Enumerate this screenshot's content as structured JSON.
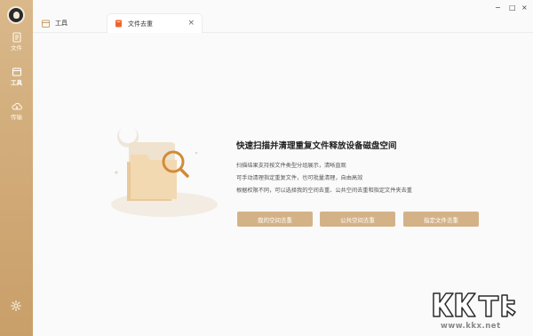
{
  "sidebar": {
    "items": [
      {
        "label": "文件",
        "icon": "file-icon"
      },
      {
        "label": "工具",
        "icon": "tools-icon"
      },
      {
        "label": "传输",
        "icon": "cloud-transfer-icon"
      }
    ],
    "settings_icon": "gear-icon",
    "logo": "app-logo"
  },
  "tabs": [
    {
      "label": "工具",
      "icon": "calendar-tools-icon"
    },
    {
      "label": "文件去重",
      "icon": "orange-file-icon",
      "close": "×"
    }
  ],
  "window_controls": {
    "minimize": "−",
    "maximize": "□",
    "close": "×"
  },
  "main": {
    "headline": "快速扫描并清理重复文件释放设备磁盘空间",
    "descriptions": [
      "扫描结果支持按文件类型分组展示，清晰直观",
      "可手动清理指定重复文件，也可批量清理，自由高效",
      "根据权限不同，可以选择我的空间去重、公共空间去重和指定文件夹去重"
    ],
    "buttons": [
      {
        "label": "我的空间去重"
      },
      {
        "label": "公共空间去重"
      },
      {
        "label": "指定文件去重"
      }
    ]
  },
  "watermark": {
    "logo": "KK下载",
    "url": "www.kkx.net"
  },
  "colors": {
    "sidebar": "#cfa875",
    "button": "#d4b287",
    "accent_orange": "#f0642a",
    "background": "#fafafa"
  }
}
